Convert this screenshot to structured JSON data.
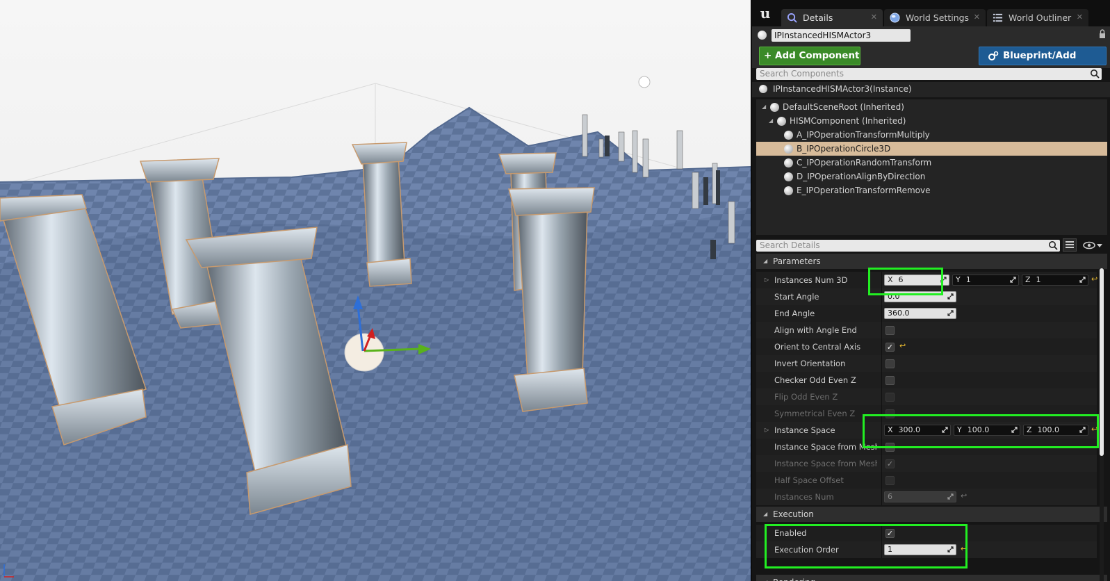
{
  "tabs": [
    {
      "label": "Details",
      "icon": "details-icon",
      "active": true
    },
    {
      "label": "World Settings",
      "icon": "globe-icon",
      "active": false
    },
    {
      "label": "World Outliner",
      "icon": "outliner-icon",
      "active": false
    }
  ],
  "actor": {
    "name": "IPInstancedHISMActor3"
  },
  "buttons": {
    "add_component": "+ Add Component ▾",
    "blueprint": "Blueprint/Add Script"
  },
  "search_components": {
    "placeholder": "Search Components"
  },
  "components": {
    "instance": "IPInstancedHISMActor3(Instance)",
    "tree": [
      {
        "label": "DefaultSceneRoot (Inherited)",
        "selected": false
      },
      {
        "label": "HISMComponent (Inherited)",
        "selected": false
      },
      {
        "label": "A_IPOperationTransformMultiply",
        "selected": false
      },
      {
        "label": "B_IPOperationCircle3D",
        "selected": true
      },
      {
        "label": "C_IPOperationRandomTransform",
        "selected": false
      },
      {
        "label": "D_IPOperationAlignByDirection",
        "selected": false
      },
      {
        "label": "E_IPOperationTransformRemove",
        "selected": false
      }
    ]
  },
  "search_details": {
    "placeholder": "Search Details"
  },
  "categories": {
    "parameters": "Parameters",
    "execution": "Execution",
    "rendering": "Rendering"
  },
  "params": {
    "instances_num_3d": {
      "label": "Instances Num 3D",
      "x": "6",
      "y": "1",
      "z": "1"
    },
    "start_angle": {
      "label": "Start Angle",
      "value": "0.0"
    },
    "end_angle": {
      "label": "End Angle",
      "value": "360.0"
    },
    "align_with_angle_end": {
      "label": "Align with Angle End",
      "checked": false
    },
    "orient_to_central_axis": {
      "label": "Orient to Central Axis",
      "checked": true
    },
    "invert_orientation": {
      "label": "Invert Orientation",
      "checked": false
    },
    "checker_odd_even_z": {
      "label": "Checker Odd Even Z",
      "checked": false
    },
    "flip_odd_even_z": {
      "label": "Flip Odd Even Z",
      "checked": false
    },
    "symmetrical_even_z": {
      "label": "Symmetrical Even Z",
      "checked": false
    },
    "instance_space": {
      "label": "Instance Space",
      "x": "300.0",
      "y": "100.0",
      "z": "100.0"
    },
    "instance_space_from_mesh_b1": {
      "label": "Instance Space from Mesh B",
      "checked": false
    },
    "instance_space_from_mesh_b2": {
      "label": "Instance Space from Mesh B",
      "checked": true
    },
    "half_space_offset": {
      "label": "Half Space Offset",
      "checked": false
    },
    "instances_num": {
      "label": "Instances Num",
      "value": "6"
    }
  },
  "execution": {
    "enabled": {
      "label": "Enabled",
      "checked": true
    },
    "execution_order": {
      "label": "Execution Order",
      "value": "1"
    }
  },
  "axis_labels": {
    "x": "X",
    "y": "Y",
    "z": "Z"
  },
  "colors": {
    "highlight": "#22ee22",
    "selection": "#d7bb9a",
    "add_button": "#3a8a28",
    "blueprint_button": "#1e5b93"
  }
}
